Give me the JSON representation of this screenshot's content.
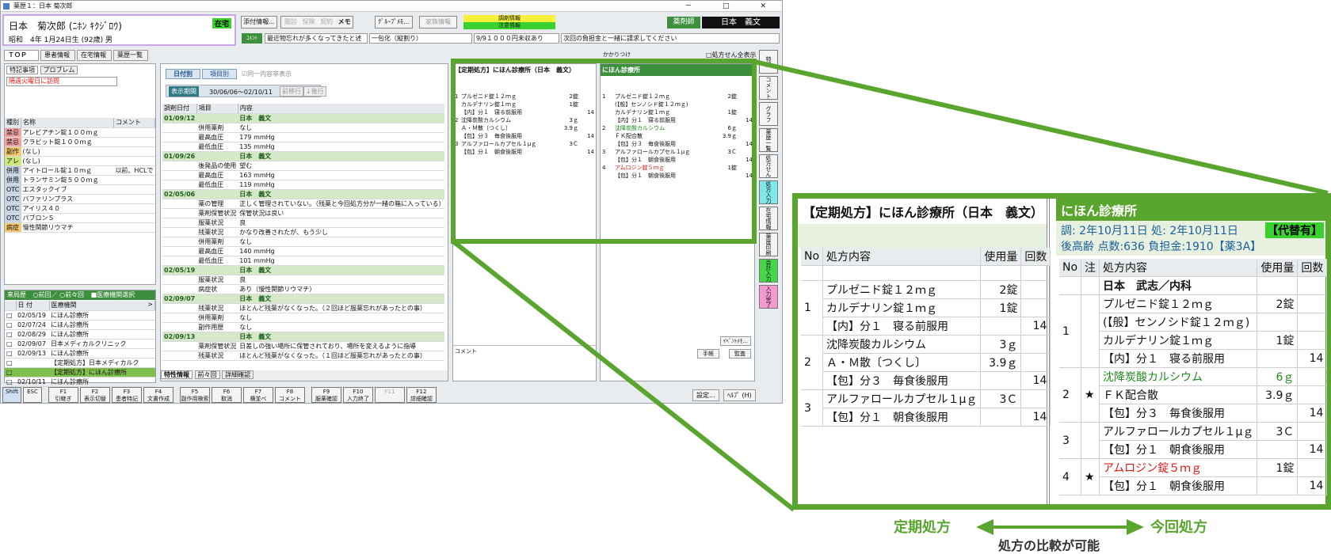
{
  "window": {
    "title": "薬歴１：日本 菊次郎",
    "controls": "－ □ ✕"
  },
  "patient": {
    "name": "日本　菊次郎 (ﾆﾎﾝ ｷｸｼﾞﾛｳ)",
    "birth": "昭和　4年 1月24日生 (92歳) 男",
    "status_badge": "在宅"
  },
  "header": {
    "buttons": {
      "attach": "添付情報...",
      "ropen": "閲診",
      "insurance": "保険",
      "contract": "契約",
      "memo": "メモ",
      "group_memo": "ｸﾞﾙｰﾌﾟﾒﾓ...",
      "family": "家族情報"
    },
    "dispense_info": "調剤情報",
    "caution_info": "注意情報",
    "pharmacist_label": "薬剤師",
    "pharmacist_name": "日本　義文",
    "comment_label": "ｺﾒﾝﾄ",
    "comments": [
      "最近物忘れが多くなってきたと述",
      "一包化（縦割り）",
      "9/9１０００円未収あり",
      "次回の負担金と一緒に請求してください"
    ]
  },
  "tabs": [
    "ＴＯＰ",
    "患者情報",
    "在宅情報",
    "薬歴一覧"
  ],
  "special": {
    "subtabs": [
      "特記事項",
      "プロブレム"
    ],
    "note": "隔週火曜日に訪問",
    "headers": [
      "種別",
      "名称",
      "コメント"
    ],
    "rows": [
      {
        "type": "禁忌",
        "name": "アレビアチン錠１００ｍｇ",
        "comment": "",
        "color": "#f3a3a3"
      },
      {
        "type": "禁忌",
        "name": "クラビット錠１００ｍｇ",
        "comment": "",
        "color": "#f3a3a3"
      },
      {
        "type": "副作",
        "name": "(なし)",
        "comment": "",
        "color": "#f5c96e"
      },
      {
        "type": "アレ",
        "name": "(なし)",
        "comment": "",
        "color": "#cfe87a"
      },
      {
        "type": "併用",
        "name": "アイトロール錠１０ｍｇ",
        "comment": "以前、HCLで",
        "color": "#c6d3e3"
      },
      {
        "type": "併用",
        "name": "トランサミン錠５００ｍｇ",
        "comment": "",
        "color": "#c6d3e3"
      },
      {
        "type": "OTC",
        "name": "エスタックイブ",
        "comment": "",
        "color": "#c6d3e3"
      },
      {
        "type": "OTC",
        "name": "バファリンプラス",
        "comment": "",
        "color": "#c6d3e3"
      },
      {
        "type": "OTC",
        "name": "アイリス４０",
        "comment": "",
        "color": "#c6d3e3"
      },
      {
        "type": "OTC",
        "name": "パブロンＳ",
        "comment": "",
        "color": "#c6d3e3"
      },
      {
        "type": "病症",
        "name": "慢性関節リウマチ",
        "comment": "",
        "color": "#f5c96e"
      }
    ]
  },
  "visits": {
    "label": "来局歴",
    "options": [
      "前回／",
      "前々回"
    ],
    "checkbox": "医療機関選択",
    "headers": [
      "日 付",
      "医療機関"
    ],
    "sort": ">",
    "rows": [
      {
        "date": "02/05/19",
        "inst": "にほん診療所"
      },
      {
        "date": "02/07/24",
        "inst": "にほん診療所"
      },
      {
        "date": "02/08/29",
        "inst": "にほん診療所"
      },
      {
        "date": "02/09/07",
        "inst": "日本メディカルクリニック"
      },
      {
        "date": "02/09/13",
        "inst": "にほん診療所"
      },
      {
        "date": "",
        "inst": "【定期処方】日本メディカルク"
      },
      {
        "date": "",
        "inst": "【定期処方】にほん診療所"
      },
      {
        "date": "02/10/11",
        "inst": "にほん診療所"
      }
    ]
  },
  "history": {
    "btn_date": "日付別",
    "btn_item": "項目別",
    "same_content": "同一内容非表示",
    "period_label": "表示期間",
    "period": "30/06/06～02/10/11",
    "prev_btn": "前移行",
    "next_btn": "↓後行",
    "headers": [
      "調剤日付",
      "項目",
      "内容"
    ],
    "groups": [
      {
        "date": "01/09/12",
        "who": "日本　義文",
        "rows": [
          [
            "併用薬剤",
            "なし"
          ],
          [
            "最高血圧",
            "179 mmHg"
          ],
          [
            "最低血圧",
            "135 mmHg"
          ]
        ]
      },
      {
        "date": "01/09/26",
        "who": "日本　義文",
        "rows": [
          [
            "後発品の使用",
            "望む"
          ],
          [
            "最高血圧",
            "163 mmHg"
          ],
          [
            "最低血圧",
            "119 mmHg"
          ]
        ]
      },
      {
        "date": "02/05/06",
        "who": "日本　義文",
        "rows": [
          [
            "薬の管理",
            "正しく管理されていない。（残薬と今回処方分が一緒の箱に入っている）"
          ],
          [
            "薬剤保管状況",
            "保管状況は良い"
          ],
          [
            "服薬状況",
            "良"
          ],
          [
            "残薬状況",
            "かなり改善されたが、もう少し"
          ],
          [
            "併用薬剤",
            "なし"
          ],
          [
            "最高血圧",
            "140 mmHg"
          ],
          [
            "最低血圧",
            "101 mmHg"
          ]
        ]
      },
      {
        "date": "02/05/19",
        "who": "日本　義文",
        "rows": [
          [
            "服薬状況",
            "良"
          ],
          [
            "病症状",
            "あり（慢性関節リウマチ）"
          ]
        ]
      },
      {
        "date": "02/09/07",
        "who": "日本　義文",
        "rows": [
          [
            "残薬状況",
            "ほとんど残薬がなくなった。（２回ほど服薬忘れがあったとの事）"
          ],
          [
            "併用薬剤",
            "なし"
          ],
          [
            "副作用歴",
            "なし"
          ]
        ]
      },
      {
        "date": "02/09/13",
        "who": "日本　義文",
        "rows": [
          [
            "薬剤保管状況",
            "日差しの強い場所に保管されており、場所を変えるように指導"
          ],
          [
            "残薬状況",
            "ほとんど残薬がなくなった。（１回ほど服薬忘れがあったとの事）"
          ]
        ]
      }
    ],
    "bottom_tabs": [
      "特性情報",
      "前々回",
      "詳細確認"
    ]
  },
  "small_rx": {
    "tag": "かかりつけ",
    "checkbox": "処方せん全表示",
    "left_title": "【定期処方】にほん診療所（日本　義文）",
    "right_title": "にほん診療所",
    "comment_label": "コメント",
    "event_btn": "ｲﾍﾞﾝﾄﾒﾓ...",
    "notebook_btn": "手帳",
    "audit_btn": "監査"
  },
  "sidebar": [
    "特記",
    "コメント",
    "グラフ",
    "薬歴一覧",
    "処方せん",
    "処方入力",
    "在宅情報",
    "薬歴印刷",
    "会計入力",
    "入力完了"
  ],
  "fkeys": [
    {
      "k": "Shift",
      "l": ""
    },
    {
      "k": "ESC",
      "l": ""
    },
    {
      "k": "F1",
      "l": "引継ぎ"
    },
    {
      "k": "F2",
      "l": "表示切替"
    },
    {
      "k": "F3",
      "l": "患者特記"
    },
    {
      "k": "F4",
      "l": "文書作成"
    },
    {
      "k": "F5",
      "l": "副作用検索"
    },
    {
      "k": "F6",
      "l": "取消"
    },
    {
      "k": "F7",
      "l": "横並べ"
    },
    {
      "k": "F8",
      "l": "コメント"
    },
    {
      "k": "F9",
      "l": "服薬確認"
    },
    {
      "k": "F10",
      "l": "入力終了"
    },
    {
      "k": "F11",
      "l": ""
    },
    {
      "k": "F12",
      "l": "詳細確認"
    }
  ],
  "footer": {
    "settings": "設定...",
    "help": "ﾍﾙﾌﾟ (H)"
  },
  "zoom": {
    "left_title": "【定期処方】にほん診療所（日本　義文）",
    "right_title": "にほん診療所",
    "right_info1": "調: 2年10月11日 処: 2年10月11日",
    "right_info2": "後高齢 点数:636 負担金:1910【薬3A】",
    "substitute": "【代替有】",
    "col_no": "No",
    "col_note": "注",
    "col_content": "処方内容",
    "col_amount": "使用量",
    "col_times": "回数",
    "right_doctor": "日本　武志／内科",
    "left_rows": [
      {
        "no": "1",
        "lines": [
          [
            "プルゼニド錠１２ｍｇ",
            "2錠"
          ],
          [
            "カルデナリン錠１ｍｇ",
            "1錠"
          ],
          [
            "【内】分１　寝る前服用",
            ""
          ]
        ],
        "times": "14"
      },
      {
        "no": "2",
        "lines": [
          [
            "沈降炭酸カルシウム",
            "3ｇ"
          ],
          [
            "Ａ・Ｍ散〔つくし〕",
            "3.9ｇ"
          ],
          [
            "【包】分３　毎食後服用",
            ""
          ]
        ],
        "times": "14"
      },
      {
        "no": "3",
        "lines": [
          [
            "アルファロールカプセル１μｇ",
            "3Ｃ"
          ],
          [
            "【包】分１　朝食後服用",
            ""
          ]
        ],
        "times": "14"
      }
    ],
    "right_rows": [
      {
        "no": "1",
        "star": "",
        "lines": [
          [
            "プルゼニド錠１２ｍｇ",
            "2錠",
            ""
          ],
          [
            "(【般】センノシド錠１２ｍｇ)",
            "",
            ""
          ],
          [
            "カルデナリン錠１ｍｇ",
            "1錠",
            ""
          ],
          [
            "【内】分１　寝る前服用",
            "",
            ""
          ]
        ],
        "times": "14"
      },
      {
        "no": "2",
        "star": "★",
        "lines": [
          [
            "沈降炭酸カルシウム",
            "6ｇ",
            "green"
          ],
          [
            "ＦＫ配合散",
            "3.9ｇ",
            ""
          ],
          [
            "【包】分３　毎食後服用",
            "",
            ""
          ]
        ],
        "times": "14"
      },
      {
        "no": "3",
        "star": "",
        "lines": [
          [
            "アルファロールカプセル１μｇ",
            "3Ｃ",
            ""
          ],
          [
            "【包】分１　朝食後服用",
            "",
            ""
          ]
        ],
        "times": "14"
      },
      {
        "no": "4",
        "star": "★",
        "lines": [
          [
            "アムロジン錠５ｍｇ",
            "1錠",
            "red"
          ],
          [
            "【包】分１　朝食後服用",
            "",
            ""
          ]
        ],
        "times": "14"
      }
    ]
  },
  "captions": {
    "left": "定期処方",
    "right": "今回処方",
    "bottom": "処方の比較が可能"
  },
  "colors": {
    "accent": "#5aa52e",
    "badge": "#38d12e",
    "date_row": "#d5e8c9"
  }
}
